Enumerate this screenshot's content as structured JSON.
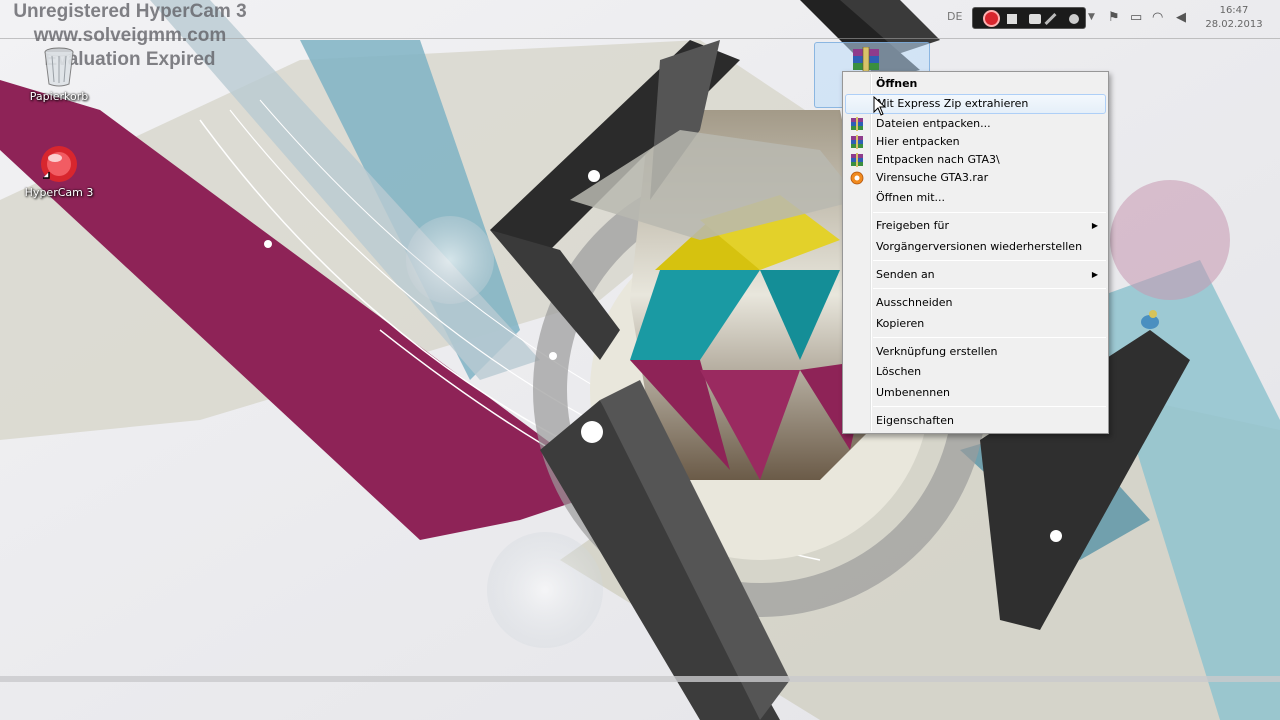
{
  "watermark": {
    "line1": "Unregistered HyperCam 3",
    "line2": "www.solveigmm.com",
    "line3": "Evaluation Expired"
  },
  "desktop": {
    "icons": [
      {
        "label": "Papierkorb",
        "icon": "recycle-bin-icon"
      },
      {
        "label": "HyperCam 3",
        "icon": "hypercam-icon"
      }
    ],
    "selected_file_icon": "winrar-archive-icon"
  },
  "taskbar": {
    "language": "DE",
    "time": "16:47",
    "date": "28.02.2013"
  },
  "context_menu": {
    "items": [
      {
        "label": "Öffnen",
        "bold": true
      },
      {
        "label": "Mit Express Zip extrahieren",
        "highlighted": true
      },
      {
        "label": "Dateien entpacken...",
        "icon": "winrar-icon"
      },
      {
        "label": "Hier entpacken",
        "icon": "winrar-icon"
      },
      {
        "label": "Entpacken nach GTA3\\",
        "icon": "winrar-icon"
      },
      {
        "label": "Virensuche GTA3.rar",
        "icon": "antivirus-icon"
      },
      {
        "label": "Öffnen mit..."
      },
      {
        "label": "Freigeben für",
        "submenu": true
      },
      {
        "label": "Vorgängerversionen wiederherstellen"
      },
      {
        "label": "Senden an",
        "submenu": true
      },
      {
        "label": "Ausschneiden"
      },
      {
        "label": "Kopieren"
      },
      {
        "label": "Verknüpfung erstellen"
      },
      {
        "label": "Löschen"
      },
      {
        "label": "Umbenennen"
      },
      {
        "label": "Eigenschaften"
      }
    ]
  },
  "colors": {
    "magenta": "#8e2357",
    "teal": "#1a9aa3",
    "yellow": "#d6c20f",
    "dark": "#2b2b2b",
    "menu_bg": "#f0f0f0",
    "highlight_border": "#aecff7"
  }
}
